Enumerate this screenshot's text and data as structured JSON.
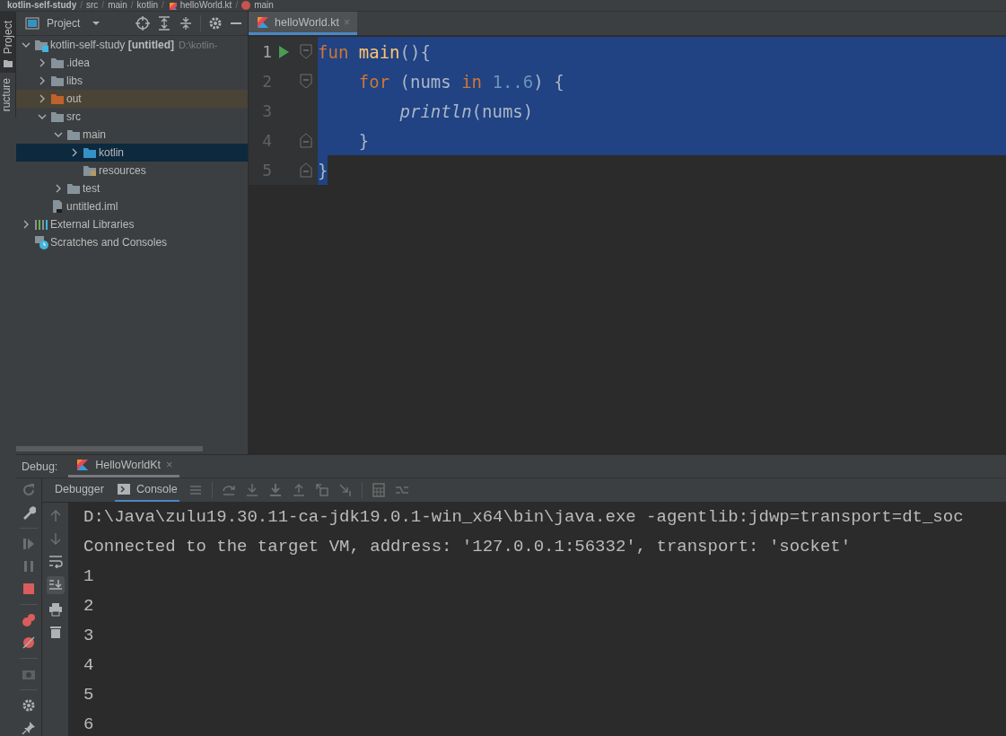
{
  "breadcrumbs": [
    {
      "label": "kotlin-self-study",
      "kind": "project"
    },
    {
      "label": "/",
      "kind": "separator"
    },
    {
      "label": "src",
      "kind": "plain"
    },
    {
      "label": "/",
      "kind": "separator"
    },
    {
      "label": "main",
      "kind": "plain"
    },
    {
      "label": "/",
      "kind": "separator"
    },
    {
      "label": "kotlin",
      "kind": "plain"
    },
    {
      "label": "/",
      "kind": "separator"
    },
    {
      "label": "helloWorld.kt",
      "kind": "file"
    },
    {
      "label": "/",
      "kind": "separator"
    },
    {
      "label": "main",
      "kind": "function"
    }
  ],
  "left_stripe": {
    "top_tab": "Project",
    "bottom_tab": "ructure"
  },
  "project_panel": {
    "title": "Project",
    "tree": [
      {
        "label": "kotlin-self-study **[untitled]**",
        "path": "D:\\kotlin-",
        "kind": "module",
        "expanded": true,
        "selected": false,
        "children": [
          {
            "label": ".idea",
            "kind": "folder",
            "expanded": false,
            "selected": false
          },
          {
            "label": "libs",
            "kind": "folder",
            "expanded": false,
            "selected": false
          },
          {
            "label": "out",
            "kind": "excluded",
            "expanded": false,
            "selected": false
          },
          {
            "label": "src",
            "kind": "folder",
            "expanded": true,
            "selected": false,
            "children": [
              {
                "label": "main",
                "kind": "folder",
                "expanded": true,
                "selected": false,
                "children": [
                  {
                    "label": "kotlin",
                    "kind": "source",
                    "expanded": false,
                    "selected": true
                  },
                  {
                    "label": "resources",
                    "kind": "resources",
                    "selected": false
                  }
                ]
              },
              {
                "label": "test",
                "kind": "folder",
                "expanded": false,
                "selected": false
              }
            ]
          },
          {
            "label": "untitled.iml",
            "kind": "iml",
            "selected": false
          }
        ]
      },
      {
        "label": "External Libraries",
        "kind": "libraries",
        "expanded": false,
        "selected": false
      },
      {
        "label": "Scratches and Consoles",
        "kind": "scratches",
        "selected": false
      }
    ]
  },
  "editor": {
    "tabs": [
      {
        "label": "helloWorld.kt",
        "close": "×",
        "selected": true
      }
    ],
    "lines": [
      {
        "number": "1",
        "run": true,
        "kind": "fold-start",
        "selected": true,
        "tokens": [
          {
            "kind": "keyword",
            "text": "fun "
          },
          {
            "kind": "function",
            "text": "main"
          },
          {
            "kind": "plain",
            "text": "(){"
          }
        ]
      },
      {
        "number": "2",
        "run": false,
        "kind": "fold-start",
        "selected": true,
        "tokens": [
          {
            "kind": "keyword",
            "text": "    for"
          },
          {
            "kind": "plain",
            "text": " (nums "
          },
          {
            "kind": "keyword",
            "text": "in "
          },
          {
            "kind": "number",
            "text": "1..6"
          },
          {
            "kind": "plain",
            "text": ") {"
          }
        ]
      },
      {
        "number": "3",
        "run": false,
        "kind": "plain",
        "selected": true,
        "tokens": [
          {
            "kind": "call",
            "text": "        println"
          },
          {
            "kind": "plain",
            "text": "(nums)"
          }
        ]
      },
      {
        "number": "4",
        "run": false,
        "kind": "fold-end",
        "selected": true,
        "tokens": [
          {
            "kind": "plain",
            "text": "    }"
          }
        ]
      },
      {
        "number": "5",
        "run": false,
        "kind": "fold-end",
        "selected": false,
        "tokens": [
          {
            "kind": "selected",
            "text": "}"
          }
        ]
      }
    ]
  },
  "debug": {
    "label": "Debug:",
    "tabs": [
      {
        "label": "HelloWorldKt",
        "close": "×",
        "selected": true
      }
    ],
    "subtabs": [
      {
        "label": "Debugger",
        "kind": "plain",
        "selected": false
      },
      {
        "label": "Console",
        "kind": "console",
        "selected": true
      }
    ],
    "console": [
      "D:\\Java\\zulu19.30.11-ca-jdk19.0.1-win_x64\\bin\\java.exe -agentlib:jdwp=transport=dt_soc",
      "Connected to the target VM, address: '127.0.0.1:56332', transport: 'socket'",
      "1",
      "2",
      "3",
      "4",
      "5",
      "6"
    ]
  }
}
